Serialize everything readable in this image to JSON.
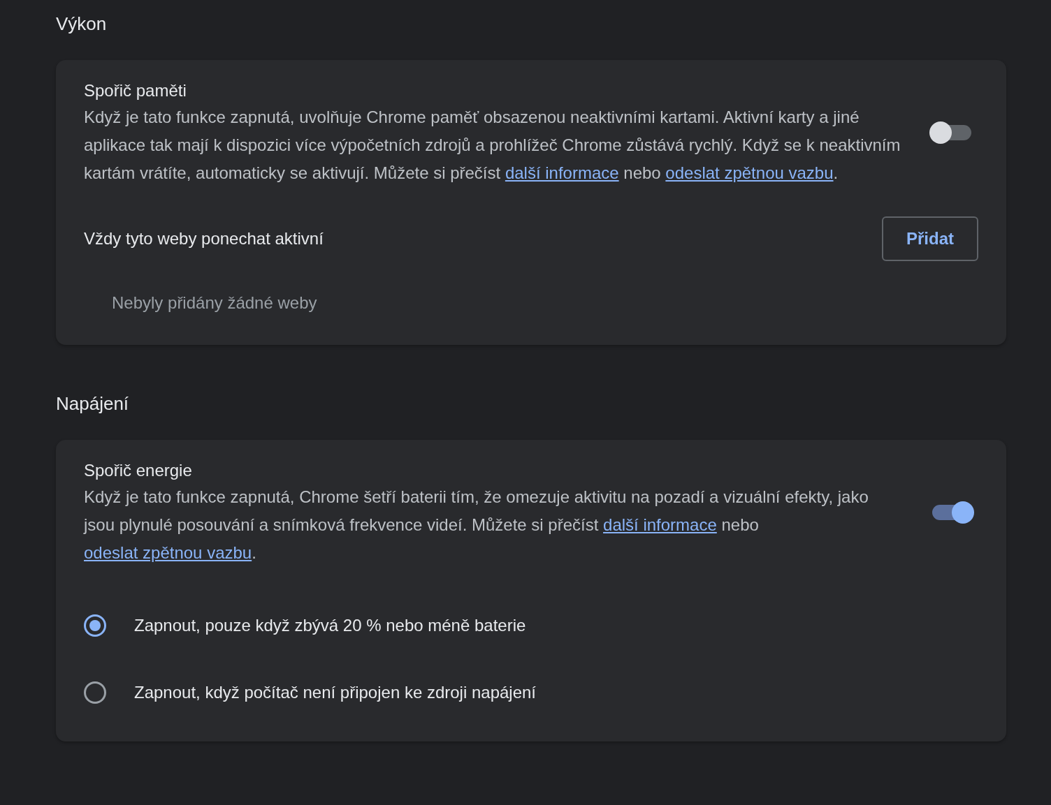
{
  "sections": [
    {
      "heading": "Výkon",
      "card": {
        "title": "Spořič paměti",
        "on": false,
        "description": [
          {
            "kind": "text",
            "text": "Když je tato funkce zapnutá, uvolňuje Chrome paměť obsazenou neaktivními kartami. Aktivní karty a jiné aplikace tak mají k dispozici více výpočetních zdrojů a prohlížeč Chrome zůstává rychlý. Když se k neaktivním kartám vrátíte, automaticky se aktivují. Můžete si přečíst "
          },
          {
            "kind": "link",
            "text": "další informace"
          },
          {
            "kind": "text",
            "text": " nebo "
          },
          {
            "kind": "link",
            "text": "odeslat zpětnou vazbu"
          },
          {
            "kind": "text",
            "text": "."
          }
        ],
        "keep_active": {
          "label": "Vždy tyto weby ponechat aktivní",
          "button": "Přidat",
          "empty": "Nebyly přidány žádné weby"
        }
      }
    },
    {
      "heading": "Napájení",
      "card": {
        "title": "Spořič energie",
        "on": true,
        "description": [
          {
            "kind": "text",
            "text": "Když je tato funkce zapnutá, Chrome šetří baterii tím, že omezuje aktivitu na pozadí a vizuální efekty, jako jsou plynulé posouvání a snímková frekvence videí. Můžete si přečíst "
          },
          {
            "kind": "link",
            "text": "další informace"
          },
          {
            "kind": "text",
            "text": " nebo "
          },
          {
            "kind": "link",
            "text": "odeslat zpětnou vazbu"
          },
          {
            "kind": "text",
            "text": "."
          }
        ],
        "options": [
          {
            "label": "Zapnout, pouze když zbývá 20 % nebo méně baterie",
            "selected": true
          },
          {
            "label": "Zapnout, když počítač není připojen ke zdroji napájení",
            "selected": false
          }
        ]
      }
    }
  ]
}
